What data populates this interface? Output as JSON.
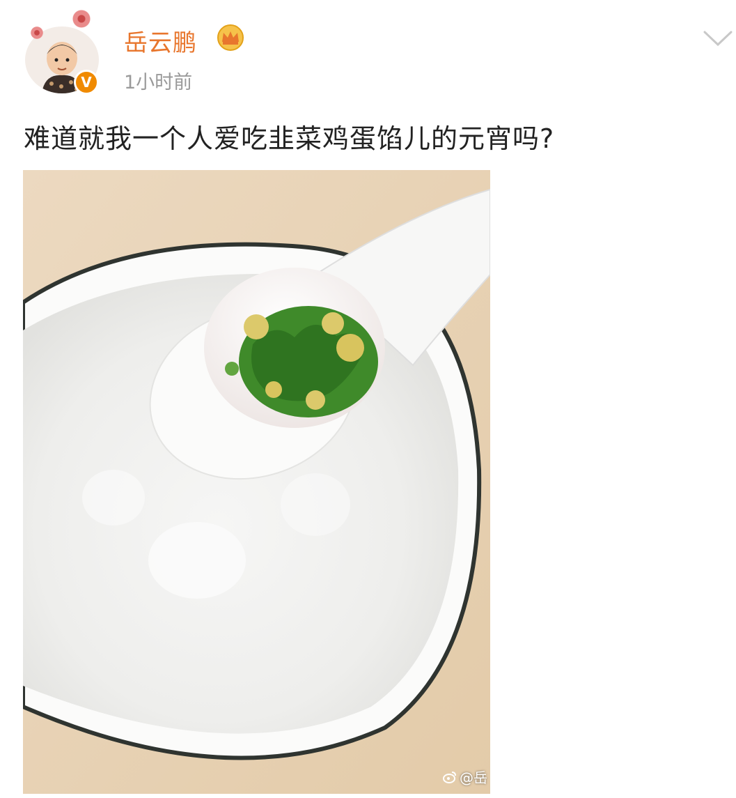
{
  "post": {
    "username": "岳云鹏",
    "timestamp": "1小时前",
    "text": "难道就我一个人爱吃韭菜鸡蛋馅儿的元宵吗?",
    "verified_mark": "V"
  },
  "photo": {
    "watermark_text": "@岳"
  },
  "icons": {
    "vip": "crown-badge-icon",
    "expand": "chevron-down-icon",
    "weibo": "weibo-logo-icon"
  },
  "colors": {
    "username": "#e8762d",
    "timestamp": "#9a9a9a",
    "verified": "#f08a00"
  }
}
